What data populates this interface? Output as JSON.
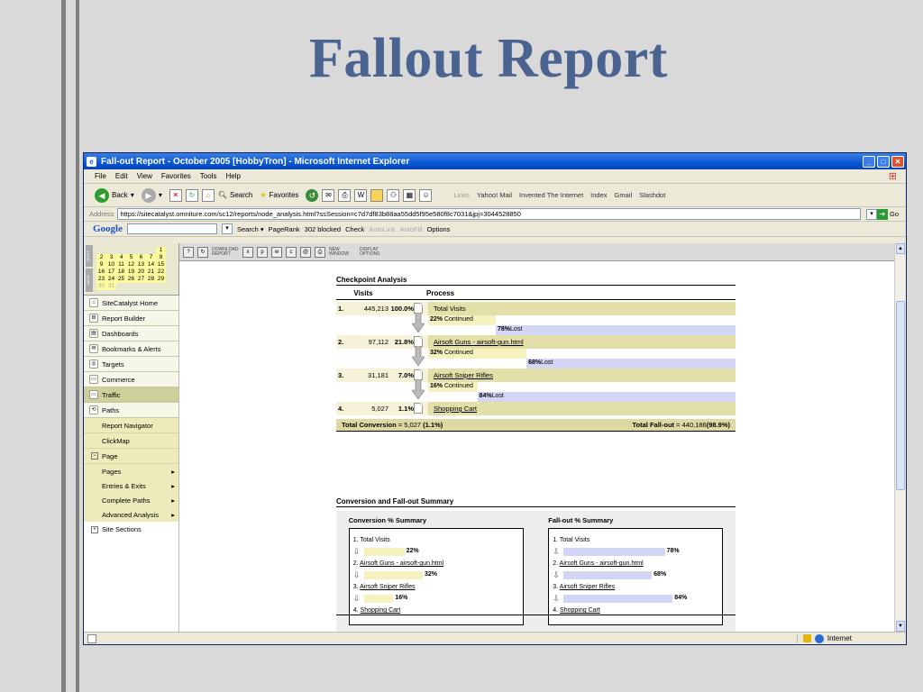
{
  "slide": {
    "title": "Fallout Report"
  },
  "window": {
    "title": "Fall-out Report - October 2005 [HobbyTron] - Microsoft Internet Explorer"
  },
  "menu": [
    "File",
    "Edit",
    "View",
    "Favorites",
    "Tools",
    "Help"
  ],
  "toolbar": {
    "back": "Back",
    "search": "Search",
    "favorites": "Favorites",
    "links_label": "Links",
    "links": [
      "Yahoo! Mail",
      "Invented The Internet",
      "Index",
      "Gmail",
      "Slashdot"
    ]
  },
  "address": {
    "label": "Address",
    "url": "https://sitecatalyst.omniture.com/sc12/reports/node_analysis.html?ssSession=c7d7df83b88aa55dd5f95e580f8c7031&jpj=3044528850",
    "go": "Go"
  },
  "google": {
    "logo": "Google",
    "search": "Search",
    "pagerank": "PageRank",
    "blocked": "302 blocked",
    "check": "Check",
    "autolink": "AutoLink",
    "autofill": "AutoFill",
    "options": "Options"
  },
  "apptoolbar": {
    "download": "DOWNLOAD REPORT",
    "newwindow": "NEW WINDOW",
    "display": "DISPLAY OPTIONS"
  },
  "calendar": {
    "month_label": "MONT",
    "days_label": "DAYS",
    "rows": [
      [
        "",
        "",
        "",
        "",
        "",
        "",
        "1"
      ],
      [
        "2",
        "3",
        "4",
        "5",
        "6",
        "7",
        "8"
      ],
      [
        "9",
        "10",
        "11",
        "12",
        "13",
        "14",
        "15"
      ],
      [
        "16",
        "17",
        "18",
        "19",
        "20",
        "21",
        "22"
      ],
      [
        "23",
        "24",
        "25",
        "26",
        "27",
        "28",
        "29"
      ],
      [
        "30",
        "31",
        "",
        "",
        "",
        "",
        ""
      ]
    ]
  },
  "sidebar": {
    "items": [
      {
        "label": "SiteCatalyst Home"
      },
      {
        "label": "Report Builder"
      },
      {
        "label": "Dashboards"
      },
      {
        "label": "Bookmarks & Alerts"
      },
      {
        "label": "Targets"
      },
      {
        "label": "Commerce"
      },
      {
        "label": "Traffic"
      },
      {
        "label": "Paths"
      }
    ],
    "paths_sub": [
      "Report Navigator",
      "ClickMap"
    ],
    "page": "Page",
    "page_sub": [
      "Pages",
      "Entries & Exits",
      "Complete Paths",
      "Advanced Analysis"
    ],
    "site_sections": "Site Sections"
  },
  "checkpoint": {
    "title": "Checkpoint Analysis",
    "col_visits": "Visits",
    "col_process": "Process",
    "rows": [
      {
        "n": "1.",
        "visits": "445,213",
        "pct": "100.0%",
        "label": "Total Visits",
        "continued": "22%",
        "lost": "78%"
      },
      {
        "n": "2.",
        "visits": "97,112",
        "pct": "21.8%",
        "label": "Airsoft Guns - airsoft-gun.html",
        "continued": "32%",
        "lost": "68%"
      },
      {
        "n": "3.",
        "visits": "31,181",
        "pct": "7.0%",
        "label": "Airsoft Sniper Rifles",
        "continued": "16%",
        "lost": "84%"
      },
      {
        "n": "4.",
        "visits": "5,027",
        "pct": "1.1%",
        "label": "Shopping Cart"
      }
    ],
    "continued_word": "Continued",
    "lost_word": "Lost",
    "total_conv_label": "Total Conversion",
    "total_conv_value": "5,027",
    "total_conv_pct": "(1.1%)",
    "total_fall_label": "Total Fall-out",
    "total_fall_value": "440,186",
    "total_fall_pct": "(98.9%)"
  },
  "summary": {
    "title": "Conversion and Fall-out Summary",
    "conv_title": "Conversion % Summary",
    "fall_title": "Fall-out % Summary",
    "steps": [
      "1. Total Visits",
      "2. ",
      "3. ",
      "4. "
    ],
    "step_links": [
      "",
      "Airsoft Guns - airsoft-gun.html",
      "Airsoft Sniper Rifles",
      "Shopping Cart"
    ],
    "conv_pcts": [
      22,
      32,
      16
    ],
    "fall_pcts": [
      78,
      68,
      84
    ]
  },
  "status": {
    "zone": "Internet"
  },
  "colors": {
    "accent": "#4b6391",
    "continued": "#f5f2bf",
    "lost": "#d3d5f4",
    "highlight": "#e3dfa9"
  }
}
